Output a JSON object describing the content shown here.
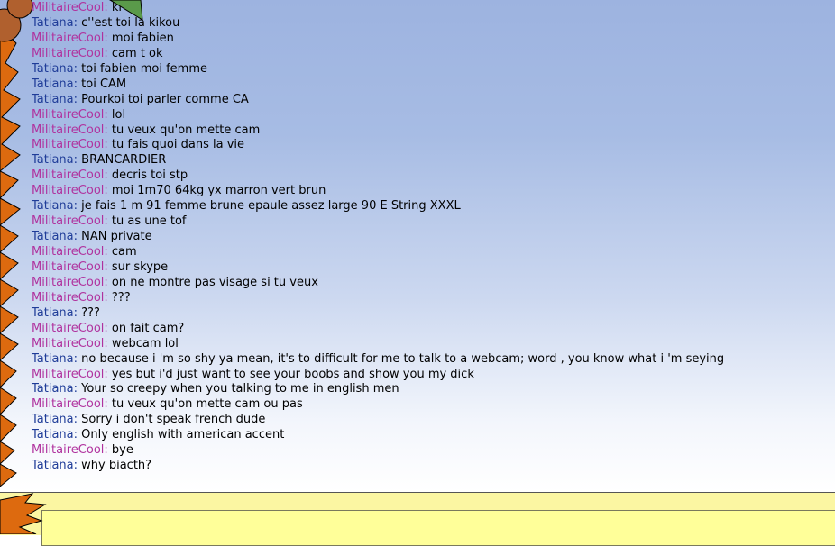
{
  "colors": {
    "militaire_nick": "#b0329e",
    "tatiana_nick": "#1f3c98",
    "input_background": "#ffff99",
    "input_bar": "#fbf6a2"
  },
  "messages": [
    {
      "nick": "MilitaireCool",
      "text": "ki t",
      "speaker": "militaire"
    },
    {
      "nick": "Tatiana",
      "text": "c''est toi la kikou",
      "speaker": "tatiana"
    },
    {
      "nick": "MilitaireCool",
      "text": "moi fabien",
      "speaker": "militaire"
    },
    {
      "nick": "MilitaireCool",
      "text": "cam t ok",
      "speaker": "militaire"
    },
    {
      "nick": "Tatiana",
      "text": "toi fabien moi femme",
      "speaker": "tatiana"
    },
    {
      "nick": "Tatiana",
      "text": "toi CAM",
      "speaker": "tatiana"
    },
    {
      "nick": "Tatiana",
      "text": "Pourkoi toi parler comme CA",
      "speaker": "tatiana"
    },
    {
      "nick": "MilitaireCool",
      "text": "lol",
      "speaker": "militaire"
    },
    {
      "nick": "MilitaireCool",
      "text": "tu veux qu'on mette cam",
      "speaker": "militaire"
    },
    {
      "nick": "MilitaireCool",
      "text": "tu fais quoi dans la vie",
      "speaker": "militaire"
    },
    {
      "nick": "Tatiana",
      "text": "BRANCARDIER",
      "speaker": "tatiana"
    },
    {
      "nick": "MilitaireCool",
      "text": "decris toi stp",
      "speaker": "militaire"
    },
    {
      "nick": "MilitaireCool",
      "text": "moi 1m70 64kg yx marron vert brun",
      "speaker": "militaire"
    },
    {
      "nick": "Tatiana",
      "text": "je fais 1 m 91 femme brune epaule assez large 90 E String XXXL",
      "speaker": "tatiana"
    },
    {
      "nick": "MilitaireCool",
      "text": "tu as une tof",
      "speaker": "militaire"
    },
    {
      "nick": "Tatiana",
      "text": "NAN private",
      "speaker": "tatiana"
    },
    {
      "nick": "MilitaireCool",
      "text": "cam",
      "speaker": "militaire"
    },
    {
      "nick": "MilitaireCool",
      "text": "sur skype",
      "speaker": "militaire"
    },
    {
      "nick": "MilitaireCool",
      "text": "on ne montre pas visage si tu veux",
      "speaker": "militaire"
    },
    {
      "nick": "MilitaireCool",
      "text": "???",
      "speaker": "militaire"
    },
    {
      "nick": "Tatiana",
      "text": "???",
      "speaker": "tatiana"
    },
    {
      "nick": "MilitaireCool",
      "text": "on fait cam?",
      "speaker": "militaire"
    },
    {
      "nick": "MilitaireCool",
      "text": "webcam lol",
      "speaker": "militaire"
    },
    {
      "nick": "Tatiana",
      "text": "no because i 'm so shy ya mean, it's to difficult for me to talk to a webcam; word , you know what i 'm seying",
      "speaker": "tatiana"
    },
    {
      "nick": "MilitaireCool",
      "text": "yes but i'd just want to see your boobs and show you my dick",
      "speaker": "militaire"
    },
    {
      "nick": "Tatiana",
      "text": "Your so creepy when you talking to me in english men",
      "speaker": "tatiana"
    },
    {
      "nick": "MilitaireCool",
      "text": "tu veux qu'on mette cam ou pas",
      "speaker": "militaire"
    },
    {
      "nick": "Tatiana",
      "text": "Sorry i don't speak french dude",
      "speaker": "tatiana"
    },
    {
      "nick": "Tatiana",
      "text": "Only english with american accent",
      "speaker": "tatiana"
    },
    {
      "nick": "MilitaireCool",
      "text": "bye",
      "speaker": "militaire"
    },
    {
      "nick": "Tatiana",
      "text": "why biacth?",
      "speaker": "tatiana"
    }
  ],
  "input": {
    "value": "",
    "placeholder": ""
  }
}
